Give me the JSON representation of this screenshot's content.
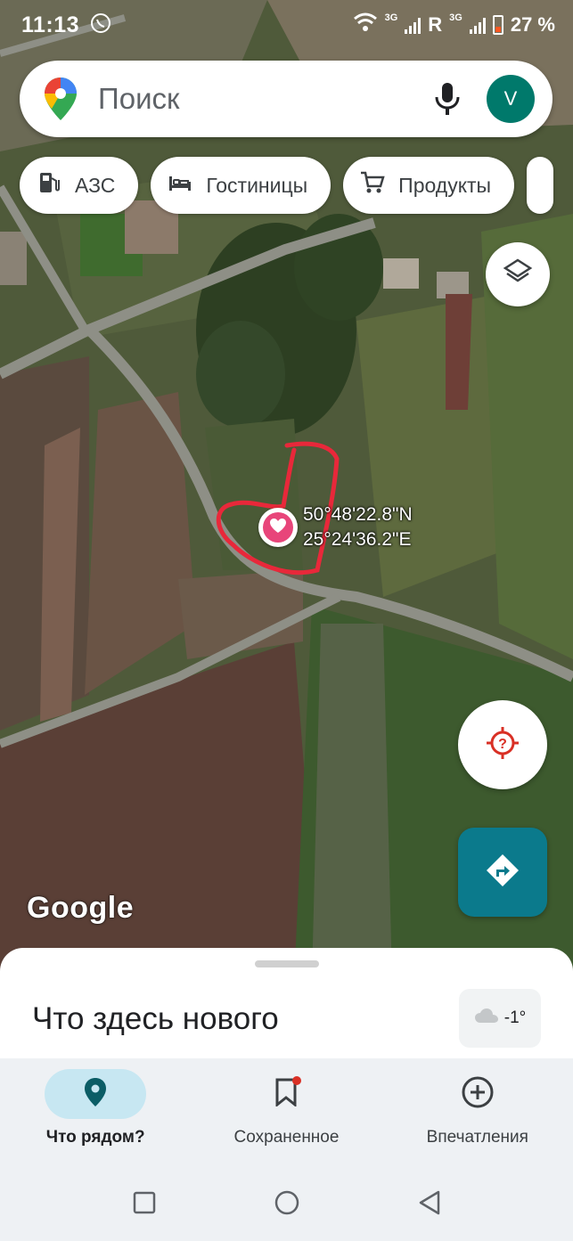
{
  "status_bar": {
    "time": "11:13",
    "network_1": "3G",
    "roaming": "R",
    "network_2": "3G",
    "battery": "27 %"
  },
  "search": {
    "placeholder": "Поиск",
    "avatar_letter": "V"
  },
  "chips": [
    {
      "label": "АЗС",
      "icon": "gas-station-icon"
    },
    {
      "label": "Гостиницы",
      "icon": "bed-icon"
    },
    {
      "label": "Продукты",
      "icon": "cart-icon"
    }
  ],
  "map": {
    "coordinates_lat": "50°48'22.8\"N",
    "coordinates_lng": "25°24'36.2\"E",
    "watermark": "Google",
    "saved_pin_icon": "heart-icon"
  },
  "sheet": {
    "title": "Что здесь нового",
    "weather_temp": "-1°",
    "weather_icon": "cloud-icon"
  },
  "bottom_nav": [
    {
      "label": "Что рядом?",
      "icon": "location-pin-icon",
      "active": true
    },
    {
      "label": "Сохраненное",
      "icon": "bookmark-icon",
      "active": false
    },
    {
      "label": "Впечатления",
      "icon": "add-circle-icon",
      "active": false
    }
  ],
  "colors": {
    "accent_teal": "#0b7a8c",
    "avatar_bg": "#00796b",
    "pin_pink": "#e8457a",
    "drawn_outline": "#e8283a"
  }
}
